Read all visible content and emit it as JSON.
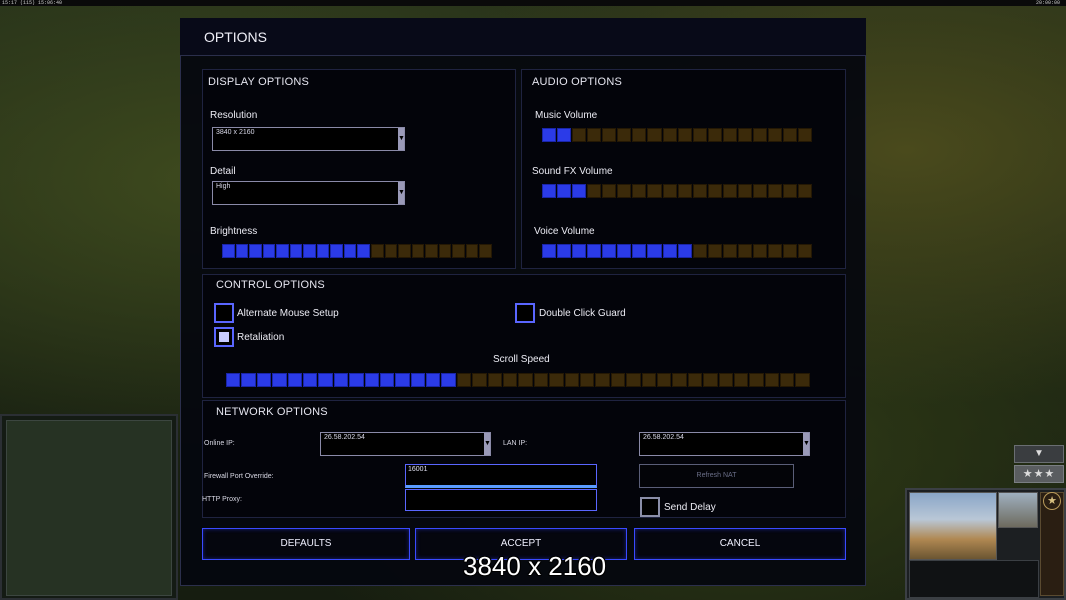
{
  "status_strip": {
    "left": "15:17 (115) 15:06:40",
    "right": "20:00:00"
  },
  "hud": {
    "star_glyph": "★",
    "arrow_glyph": "▼",
    "stars_glyph": "★★★"
  },
  "dialog": {
    "title": "OPTIONS"
  },
  "display": {
    "header": "DISPLAY OPTIONS",
    "resolution_label": "Resolution",
    "resolution_value": "3840 x 2160",
    "detail_label": "Detail",
    "detail_value": "High",
    "brightness_label": "Brightness",
    "brightness_level": 0.55
  },
  "audio": {
    "header": "AUDIO OPTIONS",
    "music_label": "Music Volume",
    "music_level": 0.1,
    "sfx_label": "Sound FX Volume",
    "sfx_level": 0.15,
    "voice_label": "Voice Volume",
    "voice_level": 0.55
  },
  "control": {
    "header": "CONTROL OPTIONS",
    "alt_mouse_label": "Alternate Mouse Setup",
    "alt_mouse_checked": false,
    "double_click_label": "Double Click Guard",
    "double_click_checked": false,
    "retaliation_label": "Retaliation",
    "retaliation_checked": true,
    "scroll_label": "Scroll Speed",
    "scroll_level": 0.39
  },
  "network": {
    "header": "NETWORK OPTIONS",
    "online_ip_label": "Online IP:",
    "online_ip_value": "26.58.202.54",
    "lan_ip_label": "LAN IP:",
    "lan_ip_value": "26.58.202.54",
    "firewall_label": "Firewall Port Override:",
    "firewall_value": "16001",
    "proxy_label": "HTTP Proxy:",
    "proxy_value": "",
    "refresh_nat_label": "Refresh NAT",
    "send_delay_label": "Send Delay",
    "send_delay_checked": false
  },
  "buttons": {
    "defaults": "DEFAULTS",
    "accept": "ACCEPT",
    "cancel": "CANCEL"
  },
  "tooltip_overlay": "3840 x 2160"
}
